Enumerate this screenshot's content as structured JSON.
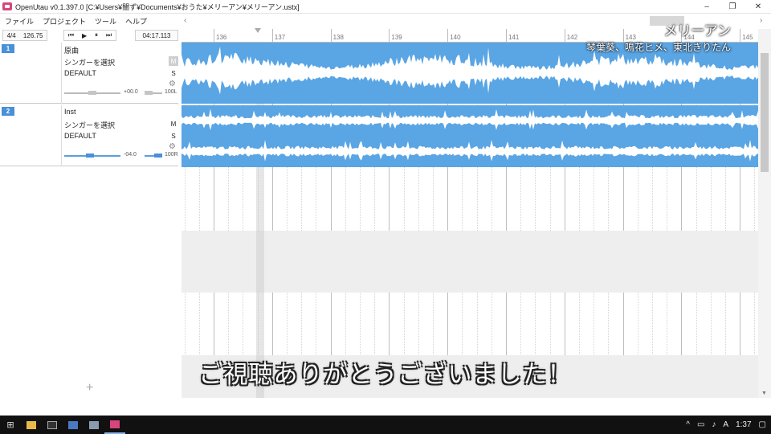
{
  "window": {
    "title": "OpenUtau v0.1.397.0 [C:¥Users¥闇ず¥Documents¥おうた¥メリーアン¥メリーアン.ustx]",
    "controls": [
      "–",
      "❐",
      "✕"
    ]
  },
  "menu": [
    "ファイル",
    "プロジェクト",
    "ツール",
    "ヘルプ"
  ],
  "transport": {
    "time_signature": "4/4",
    "bpm": "126.75",
    "buttons": [
      "⏮",
      "▶",
      "⏸",
      "⏭"
    ],
    "time": "04:17.113"
  },
  "ruler": {
    "bars": [
      "136",
      "137",
      "138",
      "139",
      "140",
      "141",
      "142",
      "143",
      "144",
      "145"
    ]
  },
  "tracks": [
    {
      "number": "1",
      "name": "原曲",
      "singer": "シンガーを選択",
      "phonemizer": "DEFAULT",
      "mute": "M",
      "solo": "S",
      "volume": "+00.0",
      "pan": "100L",
      "volume_level": 0.5,
      "pan_level": 0.0
    },
    {
      "number": "2",
      "name": "Inst",
      "singer": "シンガーを選択",
      "phonemizer": "DEFAULT",
      "mute": "M",
      "solo": "S",
      "volume": "-04.0",
      "pan": "100R",
      "volume_level": 0.45,
      "pan_level": 1.0
    }
  ],
  "overlay": {
    "song_title": "メリーアン",
    "singers": "琴葉葵、鳴花ヒメ、東北きりたん"
  },
  "subtitle": "ご視聴ありがとうございました！",
  "taskbar": {
    "clock": "1:37",
    "ime": "A"
  },
  "colors": {
    "part_blue": "#5aa5e4",
    "track_badge": "#4a90d9"
  }
}
